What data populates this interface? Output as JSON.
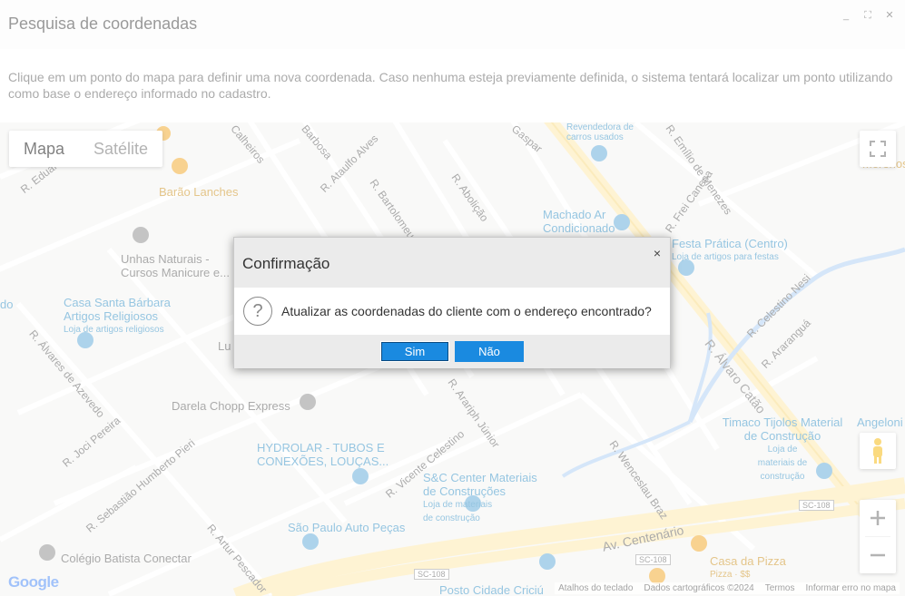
{
  "window": {
    "title": "Pesquisa de coordenadas",
    "minimize": "_",
    "maximize": "⛶",
    "close": "✕"
  },
  "instructions": "Clique em um ponto do mapa para definir uma nova coordenada. Caso nenhuma esteja previamente definida, o sistema tentará localizar um ponto utilizando como base o endereço informado no cadastro.",
  "map": {
    "map_type": {
      "map": "Mapa",
      "satellite": "Satélite"
    },
    "streets": [
      "R. Eduardo Souto",
      "R. Ataulfo Alves",
      "R. Bartolomeu de",
      "R. Abolição",
      "R. Emílio de Menezes",
      "R. Frei Caneca",
      "R. Celestino Nesi",
      "R. Araranguá",
      "R. Álvaro Catão",
      "R. Álvares de Azevedo",
      "R. Joci Pereira",
      "R. Sebastião Humberto Pieri",
      "R. Artur Pescador",
      "R. Vicente Celestino",
      "R. Arariph Júnior",
      "R. Wenceslau Braz",
      "Av. Centenário",
      "Calheiros",
      "Barbosa",
      "Gaspar",
      "SC-108",
      "SC-108",
      "SC-108"
    ],
    "pois": [
      {
        "name": "Barão Lanches",
        "color": "#c88a12"
      },
      {
        "name": "Unhas Naturais - Cursos Manicure e...",
        "color": "#555555"
      },
      {
        "name": "Casa Santa Bárbara Artigos Religiosos",
        "sub": "Loja de artigos religiosos",
        "color": "#2b8bc2"
      },
      {
        "name": "Revendedora de carros usados",
        "color": "#2b8bc2"
      },
      {
        "name": "Machado Ar Condicionado",
        "color": "#2b8bc2"
      },
      {
        "name": "Festa Prática (Centro)",
        "sub": "Loja de artigos para festas",
        "color": "#2b8bc2"
      },
      {
        "name": "Darela Chopp Express",
        "color": "#555555"
      },
      {
        "name": "HYDROLAR - TUBOS E CONEXÕES, LOUÇAS...",
        "color": "#2b8bc2"
      },
      {
        "name": "S&C Center Materiais de Construções",
        "sub": "Loja de materiais de construção",
        "color": "#2b8bc2"
      },
      {
        "name": "Timaco Tijolos Material de Construção",
        "sub": "Loja de materiais de construção",
        "color": "#2b8bc2"
      },
      {
        "name": "Angeloni",
        "color": "#2b8bc2"
      },
      {
        "name": "São Paulo Auto Peças",
        "color": "#2b8bc2"
      },
      {
        "name": "Colégio Batista Conectar",
        "color": "#555555"
      },
      {
        "name": "Casa da Pizza",
        "sub": "Pizza · $$",
        "color": "#c88a12"
      },
      {
        "name": "Posto Cidade Criciú",
        "color": "#2b8bc2"
      },
      {
        "name": "Morenos",
        "color": "#c88a12"
      },
      {
        "name": "Lu",
        "color": "#555555"
      },
      {
        "name": "do",
        "color": "#2b8bc2"
      }
    ],
    "google": "Google",
    "attribution": [
      "Atalhos do teclado",
      "Dados cartográficos ©2024",
      "Termos",
      "Informar erro no mapa"
    ]
  },
  "dialog": {
    "title": "Confirmação",
    "close": "×",
    "icon": "question-icon",
    "message": "Atualizar as coordenadas do cliente com o endereço encontrado?",
    "yes": "Sim",
    "no": "Não"
  }
}
